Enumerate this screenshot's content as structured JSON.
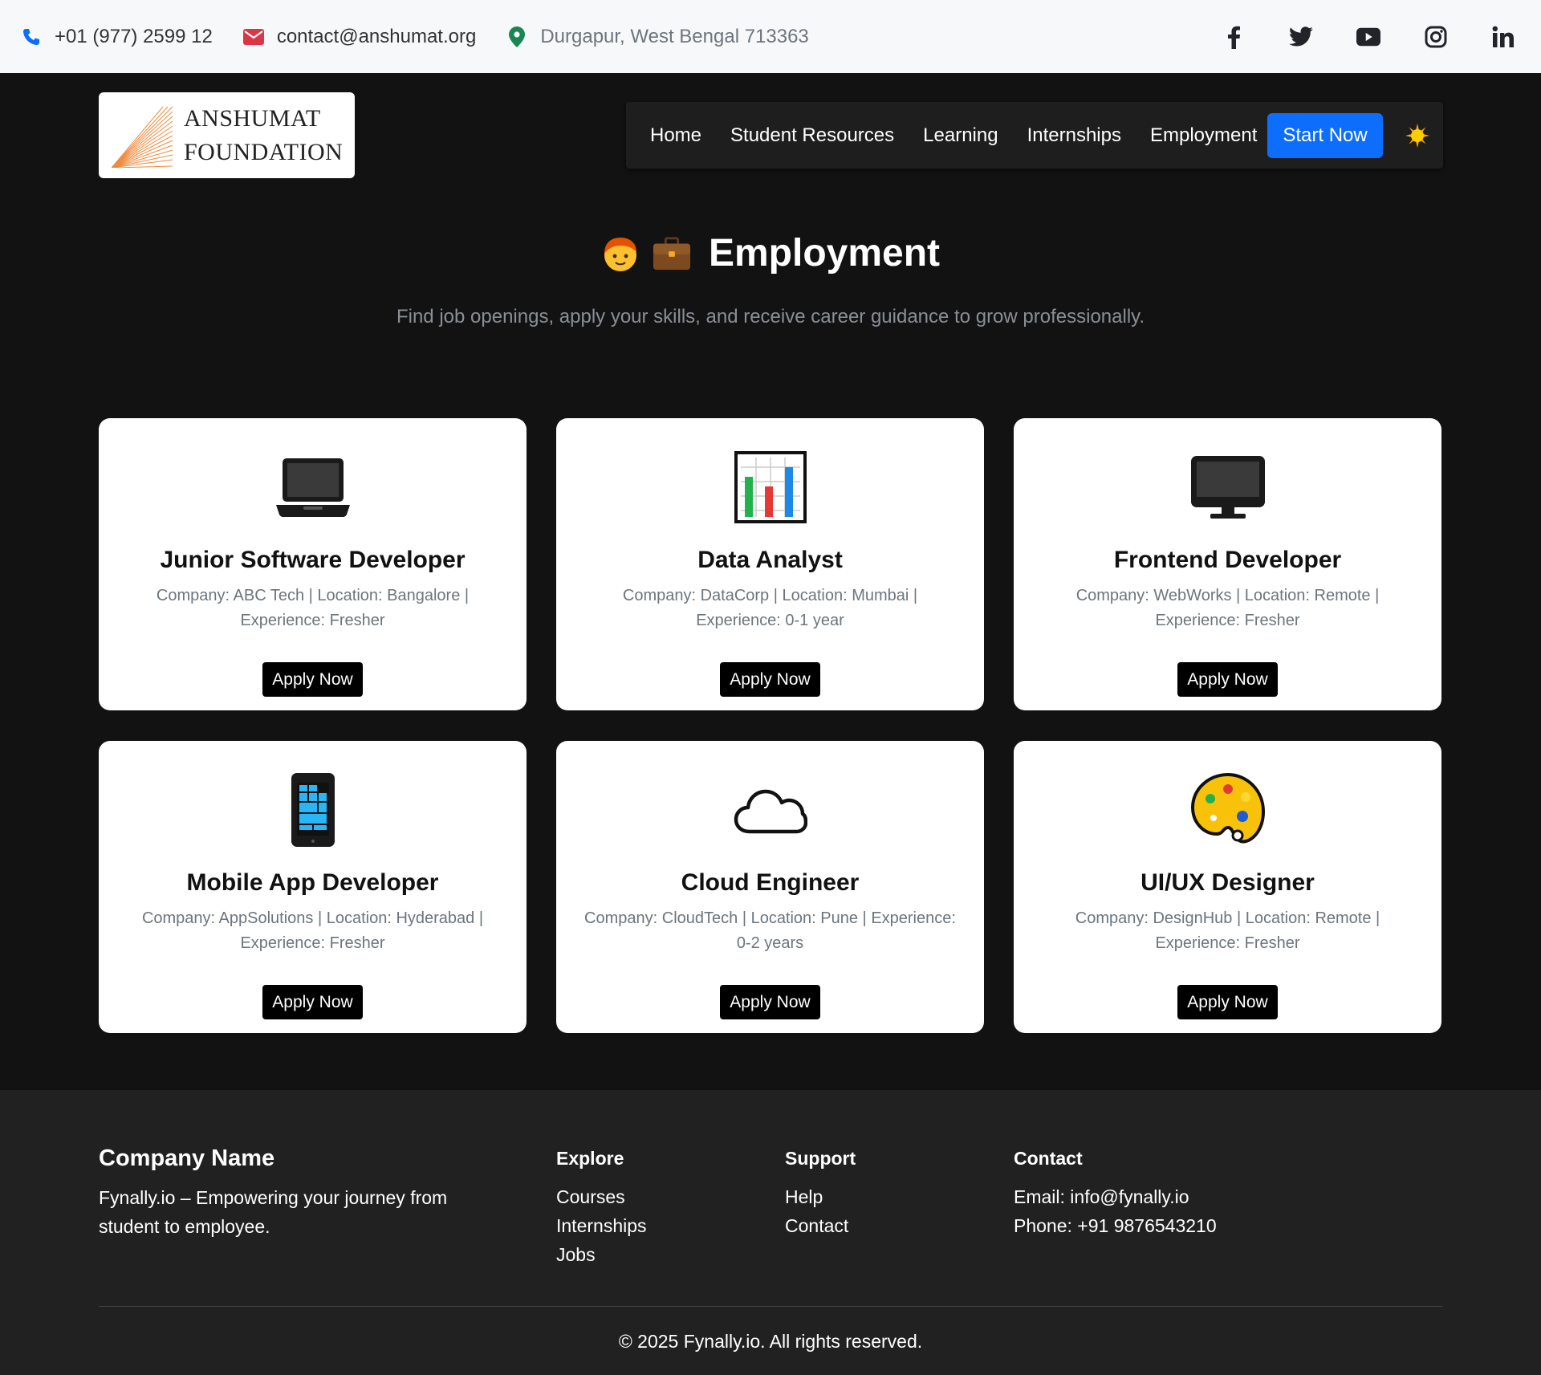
{
  "topbar": {
    "phone": "+01 (977) 2599 12",
    "email": "contact@anshumat.org",
    "address": "Durgapur, West Bengal 713363",
    "social": [
      "facebook-icon",
      "twitter-icon",
      "youtube-icon",
      "instagram-icon",
      "linkedin-icon"
    ]
  },
  "header": {
    "logo_line1": "ANSHUMAT",
    "logo_line2": "FOUNDATION",
    "nav": [
      "Home",
      "Student Resources",
      "Learning",
      "Internships",
      "Employment"
    ],
    "cta": "Start Now",
    "theme_icon": "sun-icon"
  },
  "hero": {
    "title": "Employment",
    "subtitle": "Find job openings, apply your skills, and receive career guidance to grow professionally."
  },
  "jobs": [
    {
      "icon": "laptop-icon",
      "title": "Junior Software Developer",
      "meta1": "Company: ABC Tech | Location: Bangalore |",
      "meta2": "Experience: Fresher",
      "button": "Apply Now"
    },
    {
      "icon": "bar-chart-icon",
      "title": "Data Analyst",
      "meta1": "Company: DataCorp | Location: Mumbai |",
      "meta2": "Experience: 0-1 year",
      "button": "Apply Now"
    },
    {
      "icon": "desktop-icon",
      "title": "Frontend Developer",
      "meta1": "Company: WebWorks | Location: Remote |",
      "meta2": "Experience: Fresher",
      "button": "Apply Now"
    },
    {
      "icon": "mobile-phone-icon",
      "title": "Mobile App Developer",
      "meta1": "Company: AppSolutions | Location: Hyderabad |",
      "meta2": "Experience: Fresher",
      "button": "Apply Now"
    },
    {
      "icon": "cloud-icon",
      "title": "Cloud Engineer",
      "meta1": "Company: CloudTech | Location: Pune | Experience:",
      "meta2": "0-2 years",
      "button": "Apply Now"
    },
    {
      "icon": "palette-icon",
      "title": "UI/UX Designer",
      "meta1": "Company: DesignHub | Location: Remote |",
      "meta2": "Experience: Fresher",
      "button": "Apply Now"
    }
  ],
  "footer": {
    "brand_title": "Company Name",
    "brand_text_1": "Fynally.io – Empowering your journey from",
    "brand_text_2": "student to employee.",
    "explore_title": "Explore",
    "explore_links": [
      "Courses",
      "Internships",
      "Jobs"
    ],
    "support_title": "Support",
    "support_links": [
      "Help",
      "Contact"
    ],
    "contact_title": "Contact",
    "contact_email": "Email: info@fynally.io",
    "contact_phone": "Phone: +91 9876543210",
    "copyright": "© 2025 Fynally.io. All rights reserved."
  },
  "colors": {
    "accent": "#0d6efd",
    "page_bg": "#121212",
    "footer_bg": "#212121",
    "phone_icon": "#0d6efd",
    "email_icon": "#dc3545",
    "location_icon": "#198754"
  }
}
